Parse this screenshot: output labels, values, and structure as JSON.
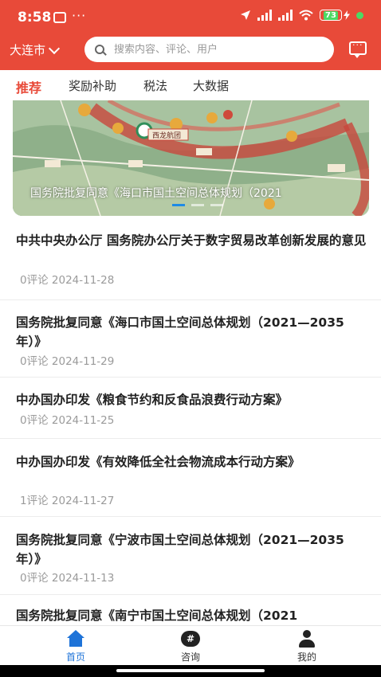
{
  "status": {
    "time": "8:58",
    "dots": "···",
    "signal_hd": "HD",
    "battery": "73"
  },
  "header": {
    "city": "大连市",
    "search_placeholder": "搜索内容、评论、用户"
  },
  "tabs": [
    {
      "label": "推荐",
      "active": true
    },
    {
      "label": "奖励补助",
      "active": false
    },
    {
      "label": "税法",
      "active": false
    },
    {
      "label": "大数据",
      "active": false
    }
  ],
  "banner": {
    "caption": "国务院批复同意《海口市国土空间总体规划（2021",
    "map_labels": [
      "西龙航团"
    ]
  },
  "articles": [
    {
      "title": "中共中央办公厅 国务院办公厅关于数字贸易改革创新发展的意见",
      "comments": "0评论",
      "date": "2024-11-28"
    },
    {
      "title": "国务院批复同意《海口市国土空间总体规划（2021—2035年）》",
      "comments": "0评论",
      "date": "2024-11-29"
    },
    {
      "title": "中办国办印发《粮食节约和反食品浪费行动方案》",
      "comments": "0评论",
      "date": "2024-11-25"
    },
    {
      "title": "中办国办印发《有效降低全社会物流成本行动方案》",
      "comments": "1评论",
      "date": "2024-11-27"
    },
    {
      "title": "国务院批复同意《宁波市国土空间总体规划（2021—2035年）》",
      "comments": "0评论",
      "date": "2024-11-13"
    },
    {
      "title": "国务院批复同意《南宁市国土空间总体规划（2021",
      "comments": "",
      "date": ""
    }
  ],
  "bottom_nav": [
    {
      "label": "首页",
      "icon": "home-icon",
      "active": true
    },
    {
      "label": "咨询",
      "icon": "chat-hash-icon",
      "active": false
    },
    {
      "label": "我的",
      "icon": "user-icon",
      "active": false
    }
  ],
  "colors": {
    "brand_red": "#e84a39",
    "active_blue": "#1e73d8",
    "meta_gray": "#9a9a9a"
  }
}
